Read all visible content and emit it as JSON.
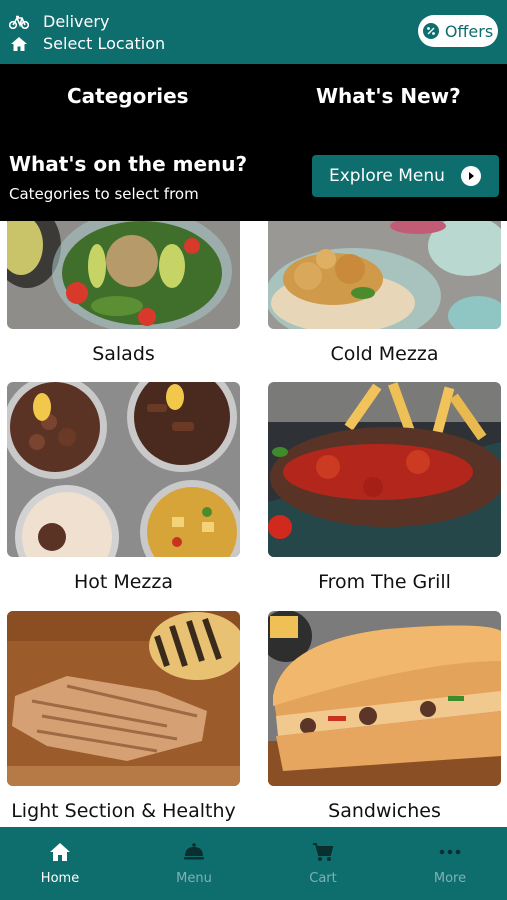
{
  "header": {
    "delivery_label": "Delivery",
    "location_label": "Select Location",
    "offers_label": "Offers"
  },
  "tabs": {
    "categories": "Categories",
    "whats_new": "What's New?"
  },
  "menu_banner": {
    "title": "What's on the menu?",
    "subtitle": "Categories to select from",
    "explore_label": "Explore Menu"
  },
  "categories": [
    {
      "label": "Salads",
      "icon": "salad-photo"
    },
    {
      "label": "Cold Mezza",
      "icon": "cold-mezza-photo"
    },
    {
      "label": "Hot Mezza",
      "icon": "hot-mezza-photo"
    },
    {
      "label": "From The Grill",
      "icon": "grill-photo"
    },
    {
      "label": "Light Section & Healthy",
      "icon": "grilled-chicken-photo"
    },
    {
      "label": "Sandwiches",
      "icon": "sandwich-photo"
    }
  ],
  "bottom_nav": [
    {
      "label": "Home",
      "icon": "home-icon",
      "active": true
    },
    {
      "label": "Menu",
      "icon": "cloche-icon",
      "active": false
    },
    {
      "label": "Cart",
      "icon": "cart-icon",
      "active": false
    },
    {
      "label": "More",
      "icon": "more-dots-icon",
      "active": false
    }
  ],
  "colors": {
    "brand_teal": "#0e6d6d",
    "header_black": "#000000",
    "inactive_nav": "#7fb2b2"
  }
}
